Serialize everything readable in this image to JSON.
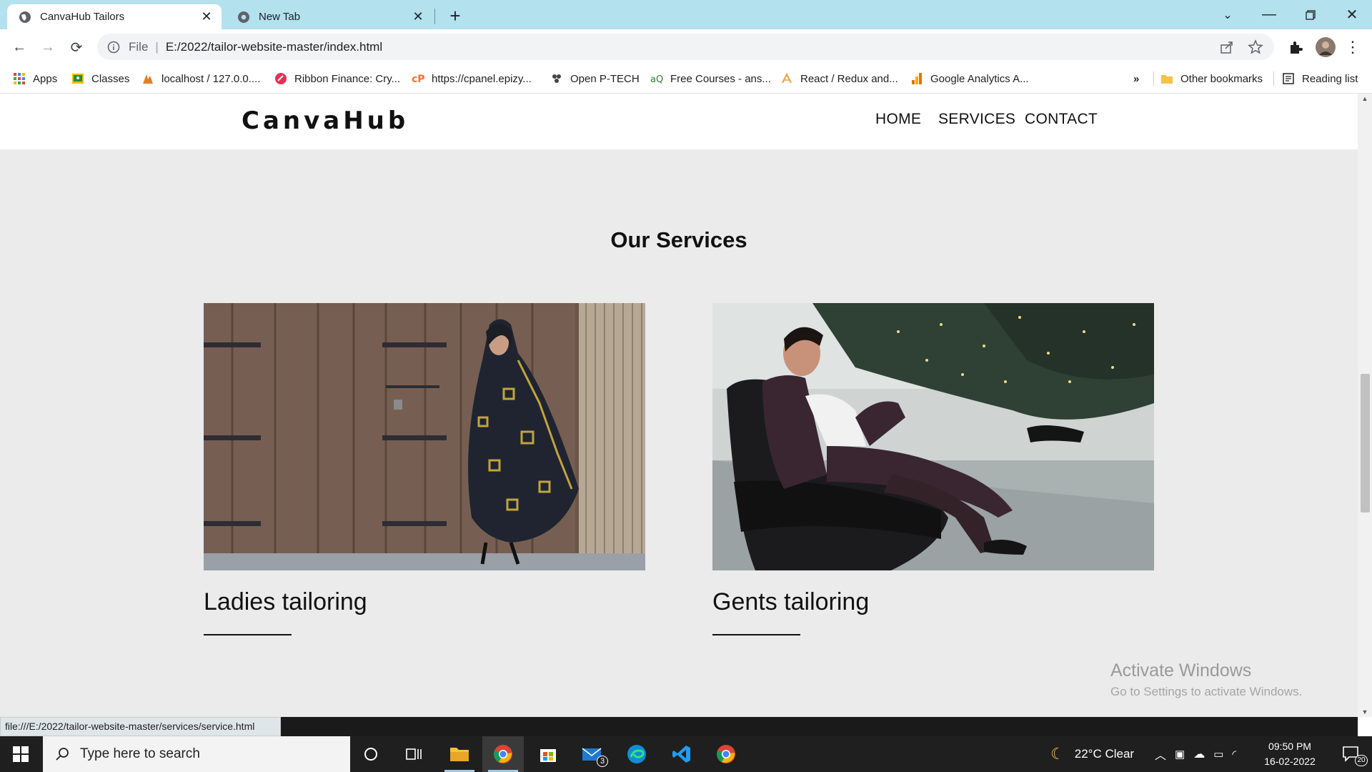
{
  "browser": {
    "tabs": [
      {
        "title": "CanvaHub Tailors",
        "active": true
      },
      {
        "title": "New Tab",
        "active": false
      }
    ],
    "address": {
      "scheme": "File",
      "url": "E:/2022/tailor-website-master/index.html"
    },
    "bookmarks": [
      {
        "label": "Apps",
        "icon": "apps-grid-icon"
      },
      {
        "label": "Classes",
        "icon": "classroom-icon"
      },
      {
        "label": "localhost / 127.0.0....",
        "icon": "phpmyadmin-icon"
      },
      {
        "label": "Ribbon Finance: Cry...",
        "icon": "ribbon-icon"
      },
      {
        "label": "https://cpanel.epizy...",
        "icon": "cpanel-icon"
      },
      {
        "label": "Open P-TECH",
        "icon": "ptech-icon"
      },
      {
        "label": "Free Courses - ans...",
        "icon": "courses-icon"
      },
      {
        "label": "React / Redux and...",
        "icon": "react-redux-icon"
      },
      {
        "label": "Google Analytics A...",
        "icon": "analytics-icon"
      }
    ],
    "bookmarks_overflow": "»",
    "other_bookmarks": "Other bookmarks",
    "reading_list": "Reading list",
    "status_url": "file:///E:/2022/tailor-website-master/services/service.html"
  },
  "site": {
    "logo": "CanvaHub",
    "nav": [
      "HOME",
      "SERVICES",
      "CONTACT"
    ],
    "section_title": "Our Services",
    "services": [
      {
        "label": "Ladies tailoring"
      },
      {
        "label": "Gents tailoring"
      }
    ]
  },
  "watermark": {
    "line1": "Activate Windows",
    "line2": "Go to Settings to activate Windows."
  },
  "taskbar": {
    "search_placeholder": "Type here to search",
    "mail_badge": "3",
    "weather": "22°C  Clear",
    "time": "09:50 PM",
    "date": "16-02-2022",
    "notifications": "20"
  }
}
